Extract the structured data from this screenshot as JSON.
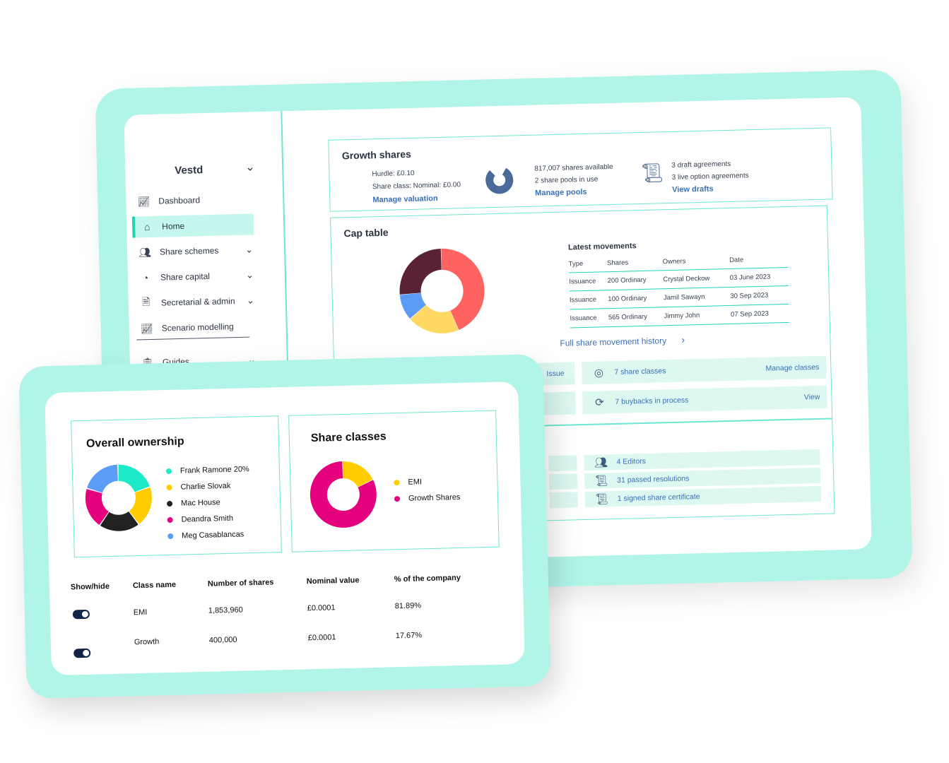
{
  "sidebar": {
    "brand": "Vestd",
    "items": [
      {
        "label": "Dashboard",
        "icon": "chart-line-icon",
        "chevron": false
      },
      {
        "label": "Home",
        "icon": "home-icon",
        "chevron": false,
        "active": true
      },
      {
        "label": "Share schemes",
        "icon": "users-icon",
        "chevron": true
      },
      {
        "label": "Share capital",
        "icon": "pie-icon",
        "chevron": true
      },
      {
        "label": "Secretarial & admin",
        "icon": "document-icon",
        "chevron": true
      },
      {
        "label": "Scenario modelling",
        "icon": "chart-line-icon",
        "chevron": false
      }
    ],
    "guides": "Guides"
  },
  "growth": {
    "title": "Growth shares",
    "hurdle": "Hurdle: £0.10",
    "share_class": "Share class: Nominal: £0.00",
    "manage_valuation": "Manage valuation",
    "shares_available": "817,007 shares available",
    "pools_in_use": "2 share pools in use",
    "manage_pools": "Manage pools",
    "draft_agreements": "3 draft agreements",
    "live_agreements": "3 live option agreements",
    "view_drafts": "View drafts"
  },
  "cap_table": {
    "title": "Cap table",
    "latest_title": "Latest movements",
    "headers": [
      "Type",
      "Shares",
      "Owners",
      "Date"
    ],
    "rows": [
      [
        "Issuance",
        "200 Ordinary",
        "Crystal Deckow",
        "03 June 2023"
      ],
      [
        "Issuance",
        "100 Ordinary",
        "Jamil Sawayn",
        "30 Sep 2023"
      ],
      [
        "Issuance",
        "565 Ordinary",
        "Jimmy John",
        "07 Sep 2023"
      ]
    ],
    "history_link": "Full share movement history",
    "issue_label": "Issue",
    "share_classes": "7 share classes",
    "manage_classes": "Manage classes",
    "buybacks": "7 buybacks in process",
    "view": "View",
    "editors": "4 Editors",
    "resolutions": "31 passed resolutions",
    "certificate": "1 signed share certificate",
    "donut_colors": [
      "#ff6361",
      "#ffd864",
      "#5b9cf6",
      "#5a2236"
    ],
    "donut_values": [
      44,
      20,
      10,
      26
    ]
  },
  "ownership": {
    "title": "Overall ownership",
    "legend": [
      {
        "label": "Frank Ramone 20%",
        "color": "#1de9c9"
      },
      {
        "label": "Charlie Slovak",
        "color": "#ffcc00"
      },
      {
        "label": "Mac House",
        "color": "#222222"
      },
      {
        "label": "Deandra Smith",
        "color": "#e5007e"
      },
      {
        "label": "Meg Casablancas",
        "color": "#5b9cf6"
      }
    ],
    "values": [
      20,
      20,
      20,
      20,
      20
    ]
  },
  "share_classes": {
    "title": "Share classes",
    "legend": [
      {
        "label": "EMI",
        "color": "#ffcc00"
      },
      {
        "label": "Growth Shares",
        "color": "#e5007e"
      }
    ],
    "values": [
      18,
      82
    ]
  },
  "classes_table": {
    "headers": [
      "Show/hide",
      "Class name",
      "Number of shares",
      "Nominal value",
      "% of the company"
    ],
    "rows": [
      [
        "EMI",
        "1,853,960",
        "£0.0001",
        "81.89%"
      ],
      [
        "Growth",
        "400,000",
        "£0.0001",
        "17.67%"
      ]
    ]
  }
}
